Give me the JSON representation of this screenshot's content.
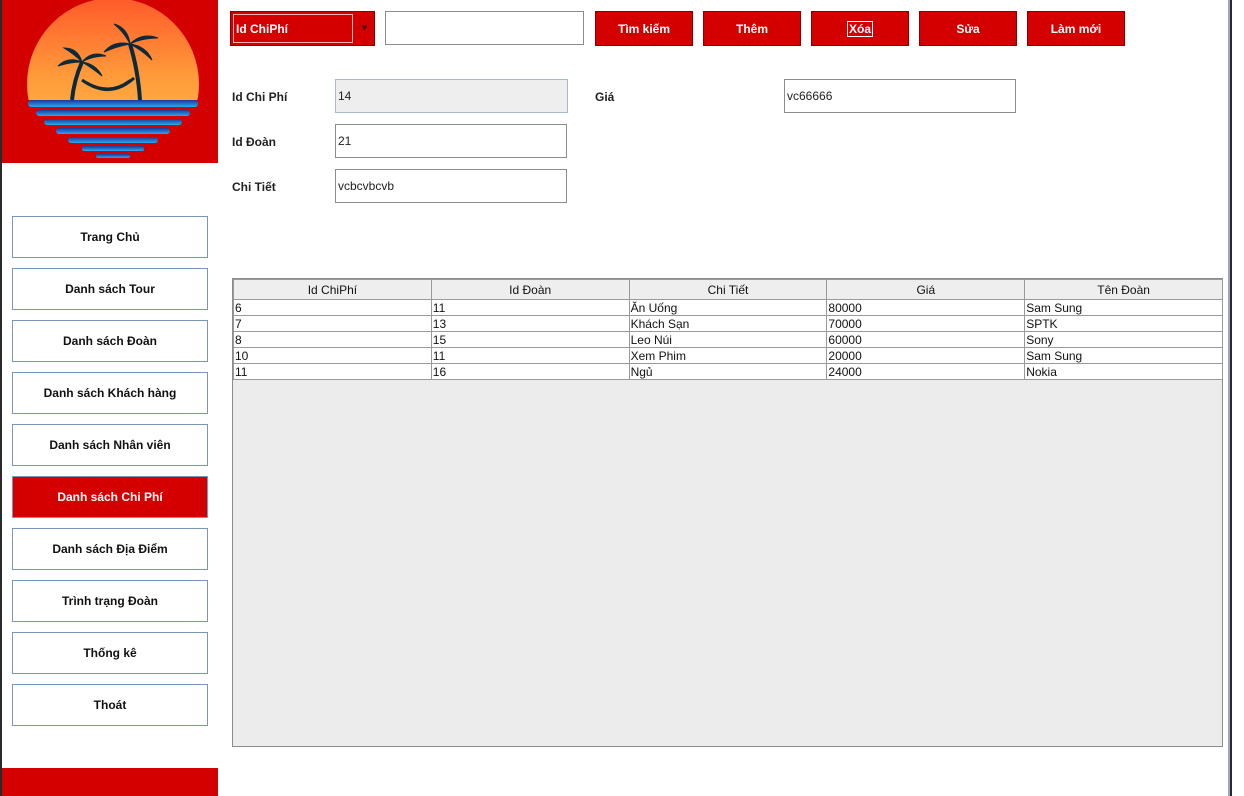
{
  "sidebar": {
    "items": [
      {
        "label": "Trang Chủ",
        "active": false
      },
      {
        "label": "Danh sách Tour",
        "active": false
      },
      {
        "label": "Danh sách Đoàn",
        "active": false
      },
      {
        "label": "Danh sách Khách hàng",
        "active": false
      },
      {
        "label": "Danh sách Nhân viên",
        "active": false
      },
      {
        "label": "Danh sách Chi Phí",
        "active": true
      },
      {
        "label": "Danh sách Địa Điểm",
        "active": false
      },
      {
        "label": "Trình trạng Đoàn",
        "active": false
      },
      {
        "label": "Thống kê",
        "active": false
      },
      {
        "label": "Thoát",
        "active": false
      }
    ]
  },
  "toolbar": {
    "search_field": "Id ChiPhí",
    "search_value": "",
    "search_label": "Tìm kiếm",
    "add_label": "Thêm",
    "delete_label": "Xóa",
    "edit_label": "Sửa",
    "refresh_label": "Làm mới"
  },
  "form": {
    "id_chiphi_label": "Id Chi Phí",
    "id_chiphi_value": "14",
    "id_doan_label": "Id Đoàn",
    "id_doan_value": "21",
    "chitiet_label": "Chi Tiết",
    "chitiet_value": "vcbcvbcvb",
    "gia_label": "Giá",
    "gia_value": "vc66666"
  },
  "table": {
    "headers": [
      "Id ChiPhí",
      "Id Đoàn",
      "Chi Tiết",
      "Giá",
      "Tên Đoàn"
    ],
    "rows": [
      [
        "6",
        "11",
        "Ăn Uống",
        "80000",
        "Sam Sung"
      ],
      [
        "7",
        "13",
        "Khách Sạn",
        "70000",
        "SPTK"
      ],
      [
        "8",
        "15",
        "Leo Núi",
        "60000",
        "Sony"
      ],
      [
        "10",
        "11",
        "Xem Phim",
        "20000",
        "Sam Sung"
      ],
      [
        "11",
        "16",
        "Ngủ",
        "24000",
        "Nokia"
      ]
    ]
  },
  "colors": {
    "brand_red": "#d40000",
    "border_blue": "#7a96b8"
  }
}
